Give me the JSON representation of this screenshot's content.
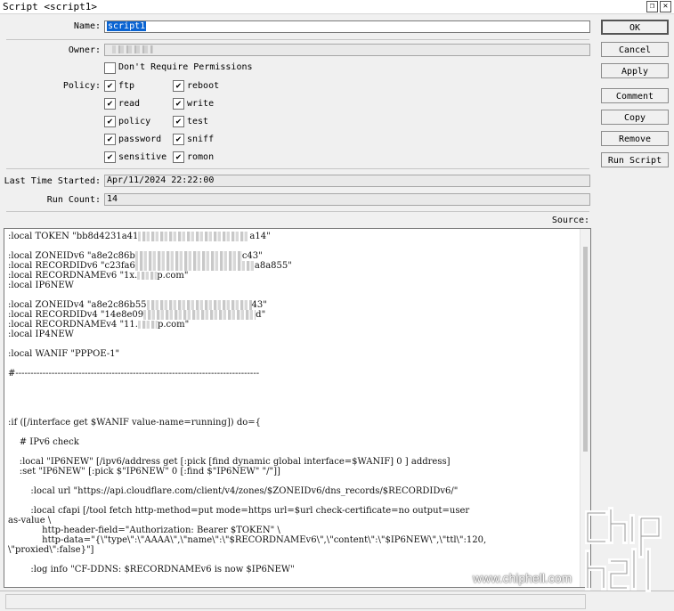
{
  "window": {
    "title": "Script <script1>",
    "restore_glyph": "❐",
    "close_glyph": "✕"
  },
  "form": {
    "name_label": "Name:",
    "name_value": "script1",
    "owner_label": "Owner:",
    "owner_value": "",
    "dont_require_label": "Don't Require Permissions",
    "policy_label": "Policy:",
    "policies": [
      {
        "label": "ftp",
        "checked": true
      },
      {
        "label": "reboot",
        "checked": true
      },
      {
        "label": "read",
        "checked": true
      },
      {
        "label": "write",
        "checked": true
      },
      {
        "label": "policy",
        "checked": true
      },
      {
        "label": "test",
        "checked": true
      },
      {
        "label": "password",
        "checked": true
      },
      {
        "label": "sniff",
        "checked": true
      },
      {
        "label": "sensitive",
        "checked": true
      },
      {
        "label": "romon",
        "checked": true
      }
    ],
    "last_started_label": "Last Time Started:",
    "last_started_value": "Apr/11/2024 22:22:00",
    "run_count_label": "Run Count:",
    "run_count_value": "14",
    "source_label": "Source:"
  },
  "buttons": {
    "ok": "OK",
    "cancel": "Cancel",
    "apply": "Apply",
    "comment": "Comment",
    "copy": "Copy",
    "remove": "Remove",
    "run_script": "Run Script"
  },
  "source": {
    "l1a": ":local TOKEN \"bb8d4231a41",
    "l1b": "a14\"",
    "l2a": ":local ZONEIDv6 \"a8e2c86b",
    "l2b": "c43\"",
    "l3a": ":local RECORDIDv6 \"c23fa6",
    "l3b": "a8a855\"",
    "l4a": ":local RECORDNAMEv6 \"1x.",
    "l4b": "p.com\"",
    "l5": ":local IP6NEW",
    "l6a": ":local ZONEIDv4 \"a8e2c86b55",
    "l6b": "43\"",
    "l7a": ":local RECORDIDv4 \"14e8e09",
    "l7b": "d\"",
    "l8a": ":local RECORDNAMEv4 \"11.",
    "l8b": "p.com\"",
    "l9": ":local IP4NEW",
    "l10": ":local WANIF \"PPPOE-1\"",
    "l11": "#---------------------------------------------------------------------------------",
    "l12": ":if ([/interface get $WANIF value-name=running]) do={",
    "l13": "    # IPv6 check",
    "l14": "    :local \"IP6NEW\" [/ipv6/address get [:pick [find dynamic global interface=$WANIF] 0 ] address]",
    "l15": "    :set \"IP6NEW\" [:pick $\"IP6NEW\" 0 [:find $\"IP6NEW\" \"/\"]]",
    "l16": "        :local url \"https://api.cloudflare.com/client/v4/zones/$ZONEIDv6/dns_records/$RECORDIDv6/\"",
    "l17": "        :local cfapi [/tool fetch http-method=put mode=https url=$url check-certificate=no output=user",
    "l18": "as-value \\",
    "l19": "            http-header-field=\"Authorization: Bearer $TOKEN\" \\",
    "l20": "            http-data=\"{\\\"type\\\":\\\"AAAA\\\",\\\"name\\\":\\\"$RECORDNAMEv6\\\",\\\"content\\\":\\\"$IP6NEW\\\",\\\"ttl\\\":120,",
    "l21": "\\\"proxied\\\":false}\"]",
    "l22": "        :log info \"CF-DDNS: $RECORDNAMEv6 is now $IP6NEW\""
  },
  "watermark": {
    "logo": "chip hell",
    "url": "www.chiphell.com"
  }
}
